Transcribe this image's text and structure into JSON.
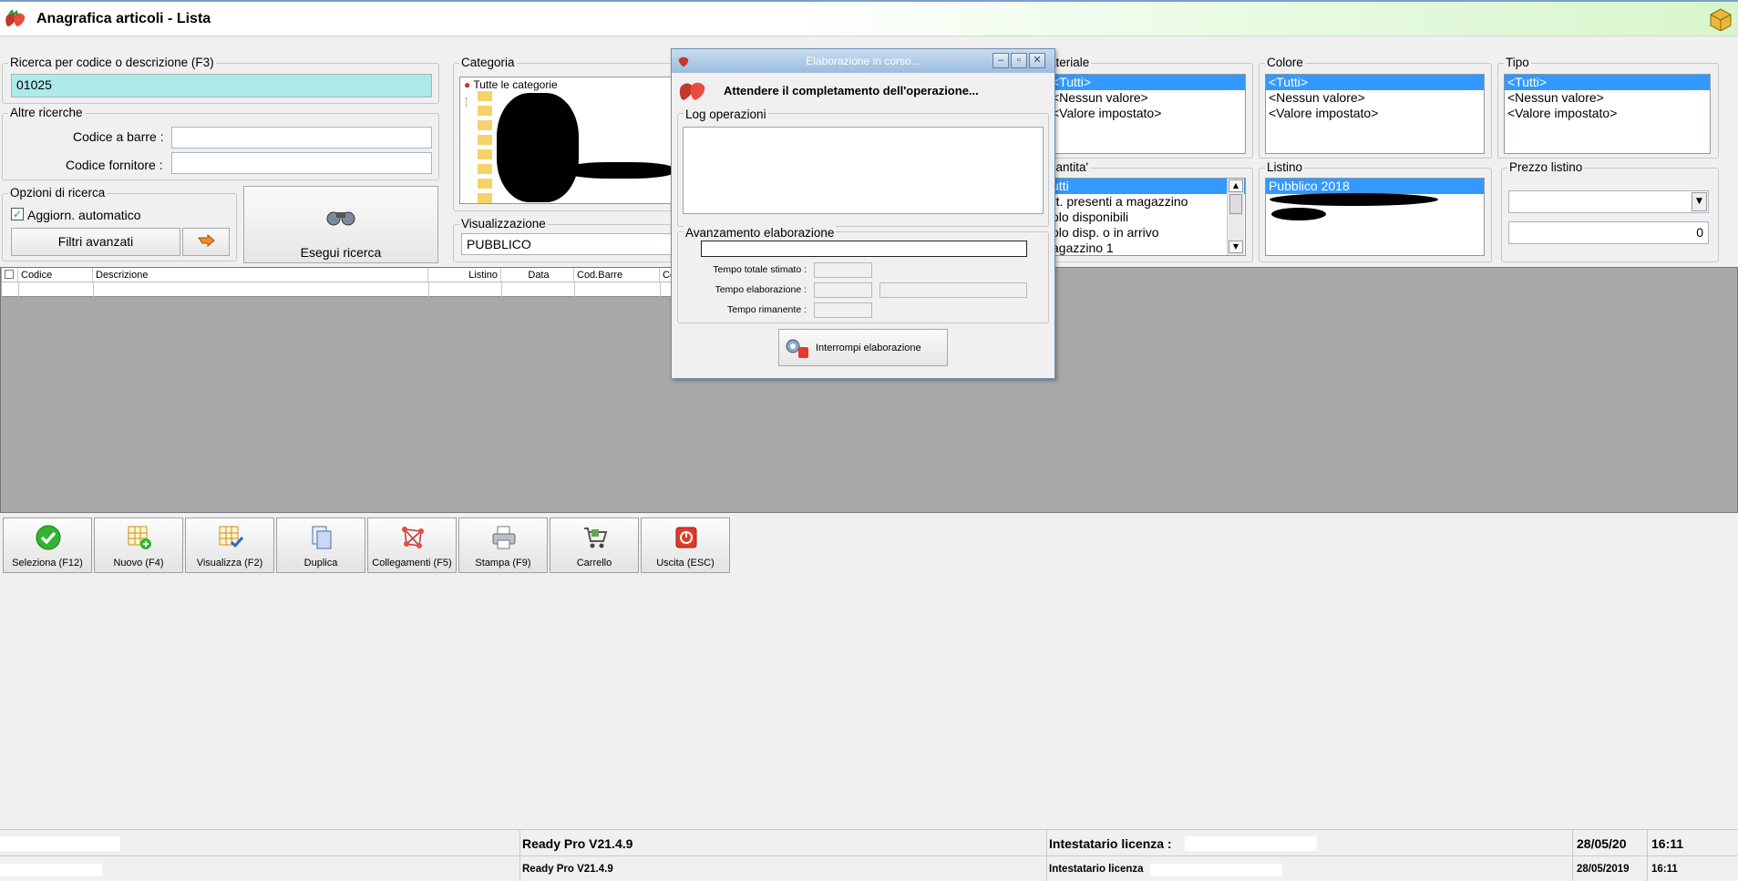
{
  "window": {
    "title": "Anagrafica articoli  - Lista"
  },
  "search": {
    "group_label": "Ricerca per codice o descrizione (F3)",
    "value": "01025",
    "other_label": "Altre ricerche",
    "barcode_label": "Codice a barre :",
    "barcode_value": "",
    "supplier_label": "Codice fornitore :",
    "supplier_value": ""
  },
  "options": {
    "group_label": "Opzioni di ricerca",
    "auto_update_label": "Aggiorn. automatico",
    "auto_update_checked": true,
    "advanced_filters_label": "Filtri avanzati",
    "run_search_label": "Esegui ricerca"
  },
  "category": {
    "group_label": "Categoria",
    "root": "Tutte le categorie"
  },
  "view": {
    "group_label": "Visualizzazione",
    "value": "PUBBLICO"
  },
  "material": {
    "group_label": "ateriale",
    "items": [
      "<Tutti>",
      "<Nessun valore>",
      "<Valore impostato>"
    ],
    "selected": 0
  },
  "color": {
    "group_label": "Colore",
    "items": [
      "<Tutti>",
      "<Nessun valore>",
      "<Valore impostato>"
    ],
    "selected": 0
  },
  "type": {
    "group_label": "Tipo",
    "items": [
      "<Tutti>",
      "<Nessun valore>",
      "<Valore impostato>"
    ],
    "selected": 0
  },
  "quantity": {
    "group_label": "uantita'",
    "items": [
      "utti",
      "rt. presenti a magazzino",
      "olo disponibili",
      "olo disp. o in arrivo",
      "agazzino 1"
    ],
    "selected": 0
  },
  "pricelist": {
    "group_label": "Listino",
    "items": [
      "Pubblico 2018"
    ],
    "selected": 0
  },
  "price": {
    "group_label": "Prezzo listino",
    "select_value": "",
    "value": "0"
  },
  "grid": {
    "columns": [
      "Codice",
      "Descrizione",
      "Listino",
      "Data",
      "Cod.Barre",
      "Co"
    ]
  },
  "toolbar": [
    {
      "label": "Seleziona (F12)",
      "icon": "check-icon"
    },
    {
      "label": "Nuovo (F4)",
      "icon": "new-grid-icon"
    },
    {
      "label": "Visualizza (F2)",
      "icon": "view-grid-icon"
    },
    {
      "label": "Duplica",
      "icon": "duplicate-icon"
    },
    {
      "label": "Collegamenti (F5)",
      "icon": "links-icon"
    },
    {
      "label": "Stampa (F9)",
      "icon": "printer-icon"
    },
    {
      "label": "Carrello",
      "icon": "cart-icon"
    },
    {
      "label": "Uscita (ESC)",
      "icon": "exit-icon"
    }
  ],
  "status1": {
    "version": "Ready Pro V21.4.9",
    "license": "Intestatario licenza :",
    "date": "28/05/20",
    "time": "16:11"
  },
  "status2": {
    "version": "Ready Pro V21.4.9",
    "license": "Intestatario licenza",
    "date": "28/05/2019",
    "time": "16:11"
  },
  "dialog": {
    "title": "Elaborazione in corso...",
    "message": "Attendere il completamento dell'operazione...",
    "log_label": "Log operazioni",
    "progress_label": "Avanzamento elaborazione",
    "progress": 0,
    "total_time_label": "Tempo totale stimato :",
    "elapsed_label": "Tempo elaborazione :",
    "remaining_label": "Tempo rimanente :",
    "stop_label": "Interrompi elaborazione"
  }
}
